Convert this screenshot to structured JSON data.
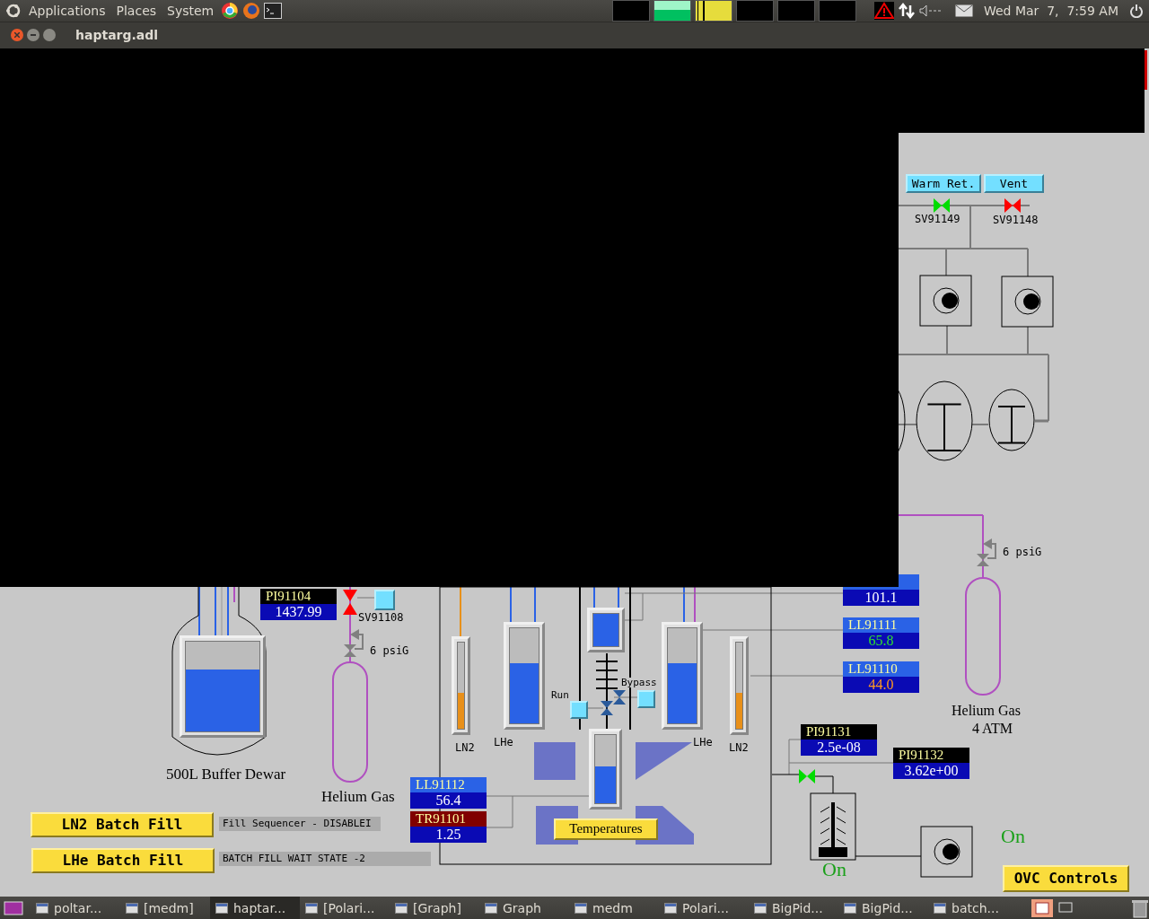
{
  "top_panel": {
    "menus": [
      "Applications",
      "Places",
      "System"
    ],
    "clock": "Wed Mar  7,  7:59 AM"
  },
  "window": {
    "title": "haptarg.adl"
  },
  "display": {
    "buttons": [
      {
        "label": "Warm Ret."
      },
      {
        "label": "Vent"
      }
    ],
    "valves": [
      {
        "label": "SV91149",
        "open": true
      },
      {
        "label": "SV91148",
        "open": false
      },
      {
        "label": "SV91108",
        "open": false
      },
      {
        "open": true
      }
    ],
    "readouts": [
      {
        "kind": "pressure",
        "name": "PI91104",
        "value": "1437.99",
        "alarm_ok": false,
        "alarm_minor": false
      },
      {
        "kind": "level",
        "value": "101.1",
        "alarm_ok": false,
        "alarm_minor": false
      },
      {
        "kind": "level",
        "name": "LL91111",
        "value": "65.8",
        "alarm_ok": true,
        "alarm_minor": false
      },
      {
        "kind": "level",
        "name": "LL91110",
        "value": "44.0",
        "alarm_ok": false,
        "alarm_minor": true
      },
      {
        "kind": "level",
        "name": "LL91112",
        "value": "56.4",
        "alarm_ok": false,
        "alarm_minor": false
      },
      {
        "kind": "temperature",
        "name": "TR91101",
        "value": "1.25",
        "alarm_ok": false,
        "alarm_minor": false
      },
      {
        "kind": "pressure",
        "name": "PI91131",
        "value": "2.5e-08",
        "alarm_ok": false,
        "alarm_minor": false
      },
      {
        "kind": "pressure",
        "name": "PI91132",
        "value": "3.62e+00",
        "alarm_ok": false,
        "alarm_minor": false
      }
    ],
    "gauges": [
      {
        "kind": "lhe",
        "level": 0.69
      },
      {
        "kind": "ln2",
        "level": 0.42
      },
      {
        "kind": "lhe",
        "level": 0.63
      },
      {
        "kind": "lhe",
        "level": 1.0
      },
      {
        "kind": "lhe",
        "level": 0.54
      },
      {
        "kind": "lhe",
        "level": 0.63
      },
      {
        "kind": "ln2",
        "level": 0.42
      }
    ],
    "labels": [
      "6 psiG",
      "Helium Gas",
      "4 ATM",
      "6 psiG",
      "500L Buffer Dewar",
      "Helium Gas",
      "LN2",
      "LHe",
      "Run",
      "Bypass",
      "LHe",
      "LN2"
    ],
    "status_lights": [
      {
        "text": "On",
        "on": true
      },
      {
        "text": "On",
        "on": true
      }
    ],
    "actions": [
      "LN2 Batch Fill",
      "LHe Batch Fill",
      "Temperatures",
      "OVC Controls"
    ],
    "status_texts": [
      "Fill Sequencer - DISABLEI",
      "BATCH FILL WAIT STATE -2"
    ]
  },
  "taskbar": [
    {
      "label": "poltar...",
      "selected": false
    },
    {
      "label": "[medm]",
      "selected": false
    },
    {
      "label": "haptar...",
      "selected": true
    },
    {
      "label": "[Polari...",
      "selected": false
    },
    {
      "label": "[Graph]",
      "selected": false
    },
    {
      "label": "Graph",
      "selected": false
    },
    {
      "label": "medm",
      "selected": false
    },
    {
      "label": "Polari...",
      "selected": false
    },
    {
      "label": "BigPid...",
      "selected": false
    },
    {
      "label": "BigPid...",
      "selected": false
    },
    {
      "label": "batch...",
      "selected": false
    }
  ]
}
